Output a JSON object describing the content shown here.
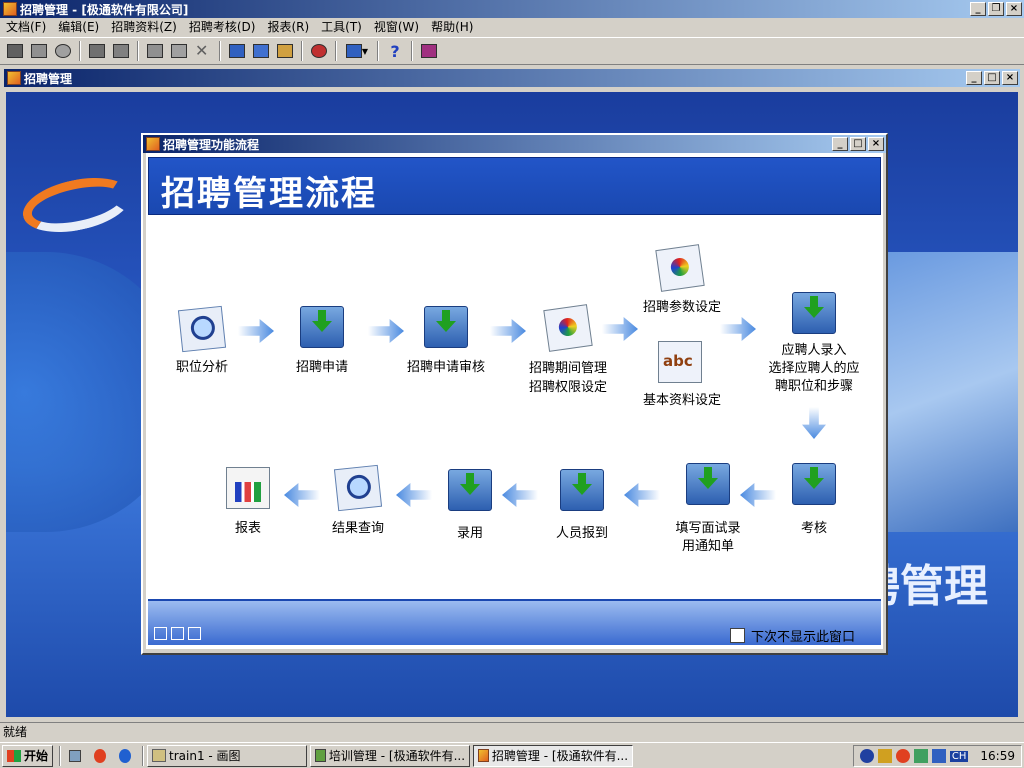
{
  "app": {
    "title": "招聘管理 - [极通软件有限公司]"
  },
  "menu": [
    "文档(F)",
    "编辑(E)",
    "招聘资料(Z)",
    "招聘考核(D)",
    "报表(R)",
    "工具(T)",
    "视窗(W)",
    "帮助(H)"
  ],
  "toolbar": {
    "icons": [
      "new-icon",
      "print-icon",
      "preview-icon",
      "window-icon",
      "export-icon",
      "edit-icon",
      "erase-icon",
      "delete-icon",
      "info-icon",
      "users-icon",
      "group-icon",
      "debug-icon",
      "layout-icon",
      "help-icon",
      "calculator-icon"
    ]
  },
  "inner_window": {
    "title": "招聘管理",
    "background_text": "聘管理"
  },
  "dialog": {
    "title": "招聘管理功能流程",
    "banner": "招聘管理流程",
    "checkbox_label": "下次不显示此窗口",
    "checkbox_checked": false,
    "nodes": {
      "job_analysis": "职位分析",
      "apply": "招聘申请",
      "apply_review": "招聘申请审核",
      "period_manage": "招聘期间管理",
      "permission": "招聘权限设定",
      "params": "招聘参数设定",
      "basic_data": "基本资料设定",
      "entry_l1": "应聘人录入",
      "entry_l2": "选择应聘人的应",
      "entry_l3": "聘职位和步骤",
      "assess": "考核",
      "notice_l1": "填写面试录",
      "notice_l2": "用通知单",
      "report_in": "人员报到",
      "hire": "录用",
      "query": "结果查询",
      "report": "报表"
    }
  },
  "status": {
    "text": "就绪"
  },
  "taskbar": {
    "start": "开始",
    "items": [
      "train1 - 画图",
      "培训管理 - [极通软件有...",
      "招聘管理 - [极通软件有..."
    ],
    "tray_lang": "CH",
    "clock": "16:59"
  }
}
